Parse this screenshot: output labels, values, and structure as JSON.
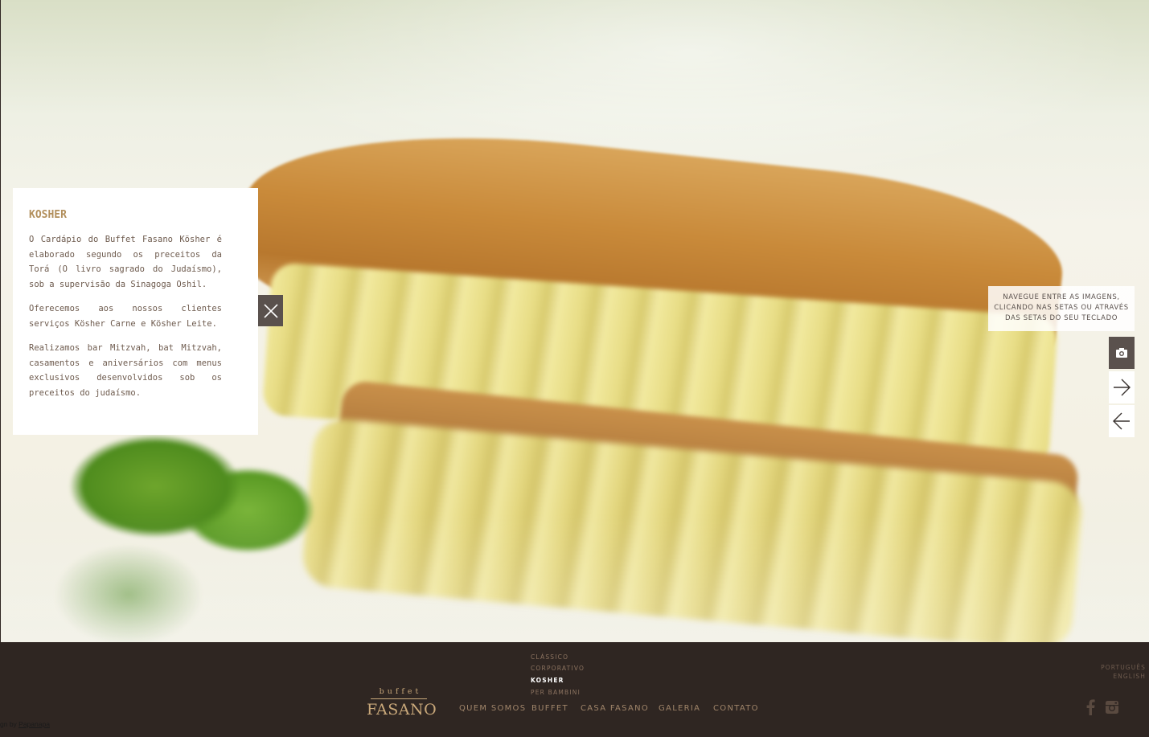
{
  "panel": {
    "title": "KOSHER",
    "paragraphs": [
      "O Cardápio do Buffet Fasano Kösher é elaborado segundo os preceitos da Torá (O livro sagrado do Judaísmo), sob a supervisão da Sinagoga Oshil.",
      "Oferecemos aos nossos clientes serviços Kösher Carne e Kösher Leite.",
      "Realizamos bar Mitzvah, bat Mitzvah, casamentos e aniversários com menus exclusivos desenvolvidos sob os preceitos do judaísmo."
    ],
    "close_icon": "close-icon"
  },
  "gallery": {
    "hint": "NAVEGUE ENTRE AS IMAGENS, CLICANDO NAS SETAS OU ATRAVÉS DAS SETAS DO SEU TECLADO",
    "camera_icon": "camera-icon",
    "next_icon": "arrow-right-icon",
    "prev_icon": "arrow-left-icon"
  },
  "footer": {
    "logo_top": "buffet",
    "logo_main": "FASANO",
    "nav": [
      "QUEM SOMOS",
      "BUFFET",
      "CASA FASANO",
      "GALERIA",
      "CONTATO"
    ],
    "subnav": [
      "CLÁSSICO",
      "CORPORATIVO",
      "KOSHER",
      "PER BAMBINI"
    ],
    "subnav_active": "KOSHER",
    "languages": [
      "PORTUGUÊS",
      "ENGLISH"
    ],
    "social": [
      "facebook-icon",
      "instagram-icon"
    ],
    "credit_prefix": "gn by ",
    "credit_link": "Papanapa"
  },
  "colors": {
    "footer_bg": "#2f2622",
    "accent_gold": "#c9a87a",
    "panel_title": "#b28f5c",
    "control_dark": "#5a514d"
  }
}
